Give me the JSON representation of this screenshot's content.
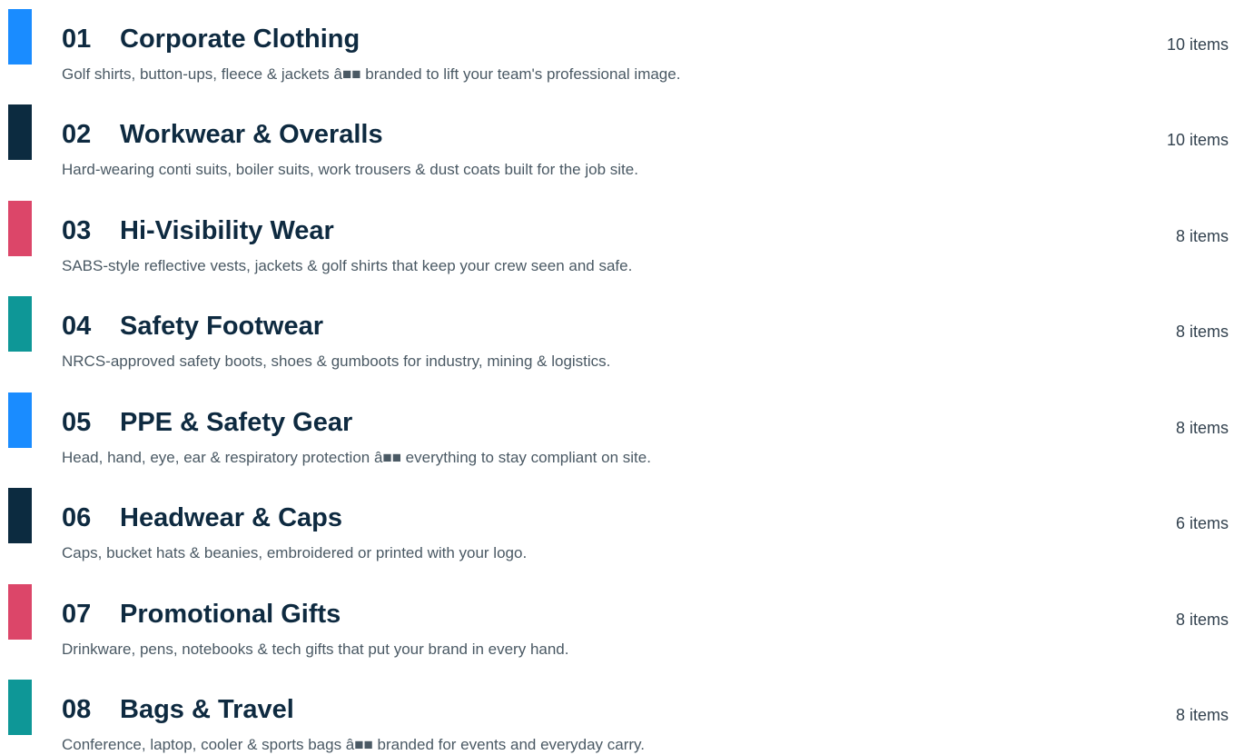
{
  "colors": {
    "blue": "#1a8cff",
    "navy": "#0c2b40",
    "pink": "#dc4669",
    "teal": "#0e9797",
    "heading": "#0e2a40",
    "description": "#4a5964"
  },
  "categories": [
    {
      "number": "01",
      "title": "Corporate Clothing",
      "description": "Golf shirts, button-ups, fleece & jackets â■■ branded to lift your team's professional image.",
      "count": "10 items",
      "accent": "#1a8cff"
    },
    {
      "number": "02",
      "title": "Workwear & Overalls",
      "description": "Hard-wearing conti suits, boiler suits, work trousers & dust coats built for the job site.",
      "count": "10 items",
      "accent": "#0c2b40"
    },
    {
      "number": "03",
      "title": "Hi-Visibility Wear",
      "description": "SABS-style reflective vests, jackets & golf shirts that keep your crew seen and safe.",
      "count": "8 items",
      "accent": "#dc4669"
    },
    {
      "number": "04",
      "title": "Safety Footwear",
      "description": "NRCS-approved safety boots, shoes & gumboots for industry, mining & logistics.",
      "count": "8 items",
      "accent": "#0e9797"
    },
    {
      "number": "05",
      "title": "PPE & Safety Gear",
      "description": "Head, hand, eye, ear & respiratory protection â■■ everything to stay compliant on site.",
      "count": "8 items",
      "accent": "#1a8cff"
    },
    {
      "number": "06",
      "title": "Headwear & Caps",
      "description": "Caps, bucket hats & beanies, embroidered or printed with your logo.",
      "count": "6 items",
      "accent": "#0c2b40"
    },
    {
      "number": "07",
      "title": "Promotional Gifts",
      "description": "Drinkware, pens, notebooks & tech gifts that put your brand in every hand.",
      "count": "8 items",
      "accent": "#dc4669"
    },
    {
      "number": "08",
      "title": "Bags & Travel",
      "description": "Conference, laptop, cooler & sports bags â■■ branded for events and everyday carry.",
      "count": "8 items",
      "accent": "#0e9797"
    }
  ]
}
